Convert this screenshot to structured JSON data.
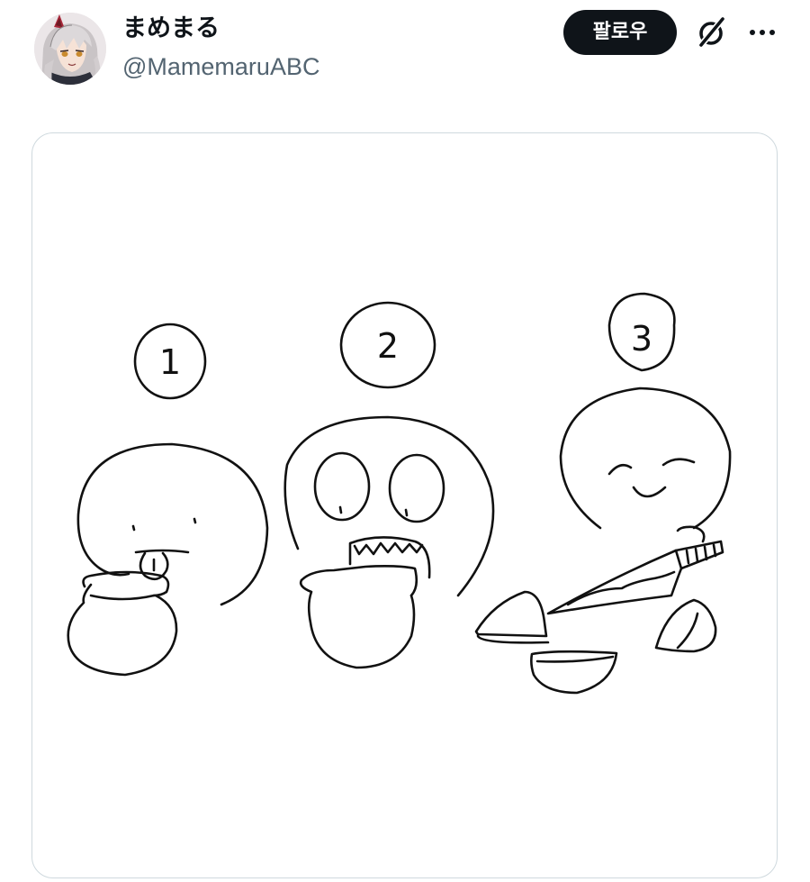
{
  "tweet": {
    "author": {
      "display_name": "まめまる",
      "handle": "@MamemaruABC",
      "avatar_icon": "anime-character-avatar"
    },
    "actions": {
      "follow_label": "팔로우",
      "grok_icon": "grok-icon",
      "more_icon": "more-options-icon"
    },
    "media": {
      "step_labels": [
        "1",
        "2",
        "3"
      ]
    }
  }
}
